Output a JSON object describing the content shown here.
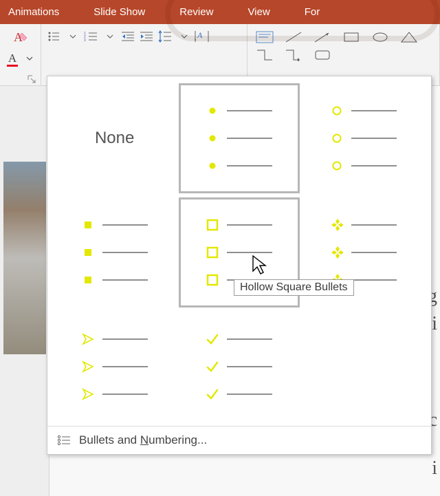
{
  "tabs": {
    "animations": "Animations",
    "slide_show": "Slide Show",
    "review": "Review",
    "view": "View",
    "format_partial": "For"
  },
  "bullet_gallery": {
    "none_label": "None",
    "tooltip": "Hollow Square Bullets",
    "options": [
      {
        "name": "none"
      },
      {
        "name": "filled-round"
      },
      {
        "name": "hollow-round"
      },
      {
        "name": "filled-square"
      },
      {
        "name": "hollow-square"
      },
      {
        "name": "four-diamond"
      },
      {
        "name": "arrow"
      },
      {
        "name": "checkmark"
      }
    ],
    "selected": "filled-round",
    "hover": "hollow-square",
    "footer_label_prefix": "Bullets and ",
    "footer_label_underline": "N",
    "footer_label_suffix": "umbering...",
    "accent_color": "#e3e800"
  },
  "slide_text_fragments": [
    "g",
    "i",
    "c",
    "i"
  ]
}
